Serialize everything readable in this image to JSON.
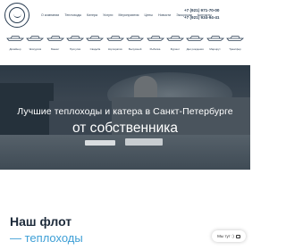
{
  "header": {
    "nav": [
      "О компании",
      "Теплоходы",
      "Катера",
      "Услуги",
      "Мероприятия",
      "Цены",
      "Новости",
      "Экскурсии",
      "Контакты"
    ],
    "phones": [
      "+7 (921) 971-70-00",
      "+7 (921) 934-94-41"
    ]
  },
  "categories": [
    "Дизайнер",
    "Экскурсия",
    "Банкет",
    "Прогулки",
    "Свадьба",
    "Корпоратив",
    "Выпускной",
    "Рыбалка",
    "Фуршет",
    "Дни рождения",
    "Маршрут",
    "Трансфер"
  ],
  "hero": {
    "title": "Лучшие теплоходы и катера в Санкт-Петербурге",
    "subtitle": "от собственника"
  },
  "fleet": {
    "title": "Наш флот",
    "subtitle": "— теплоходы"
  },
  "chat": {
    "label": "Мы тут :)"
  }
}
